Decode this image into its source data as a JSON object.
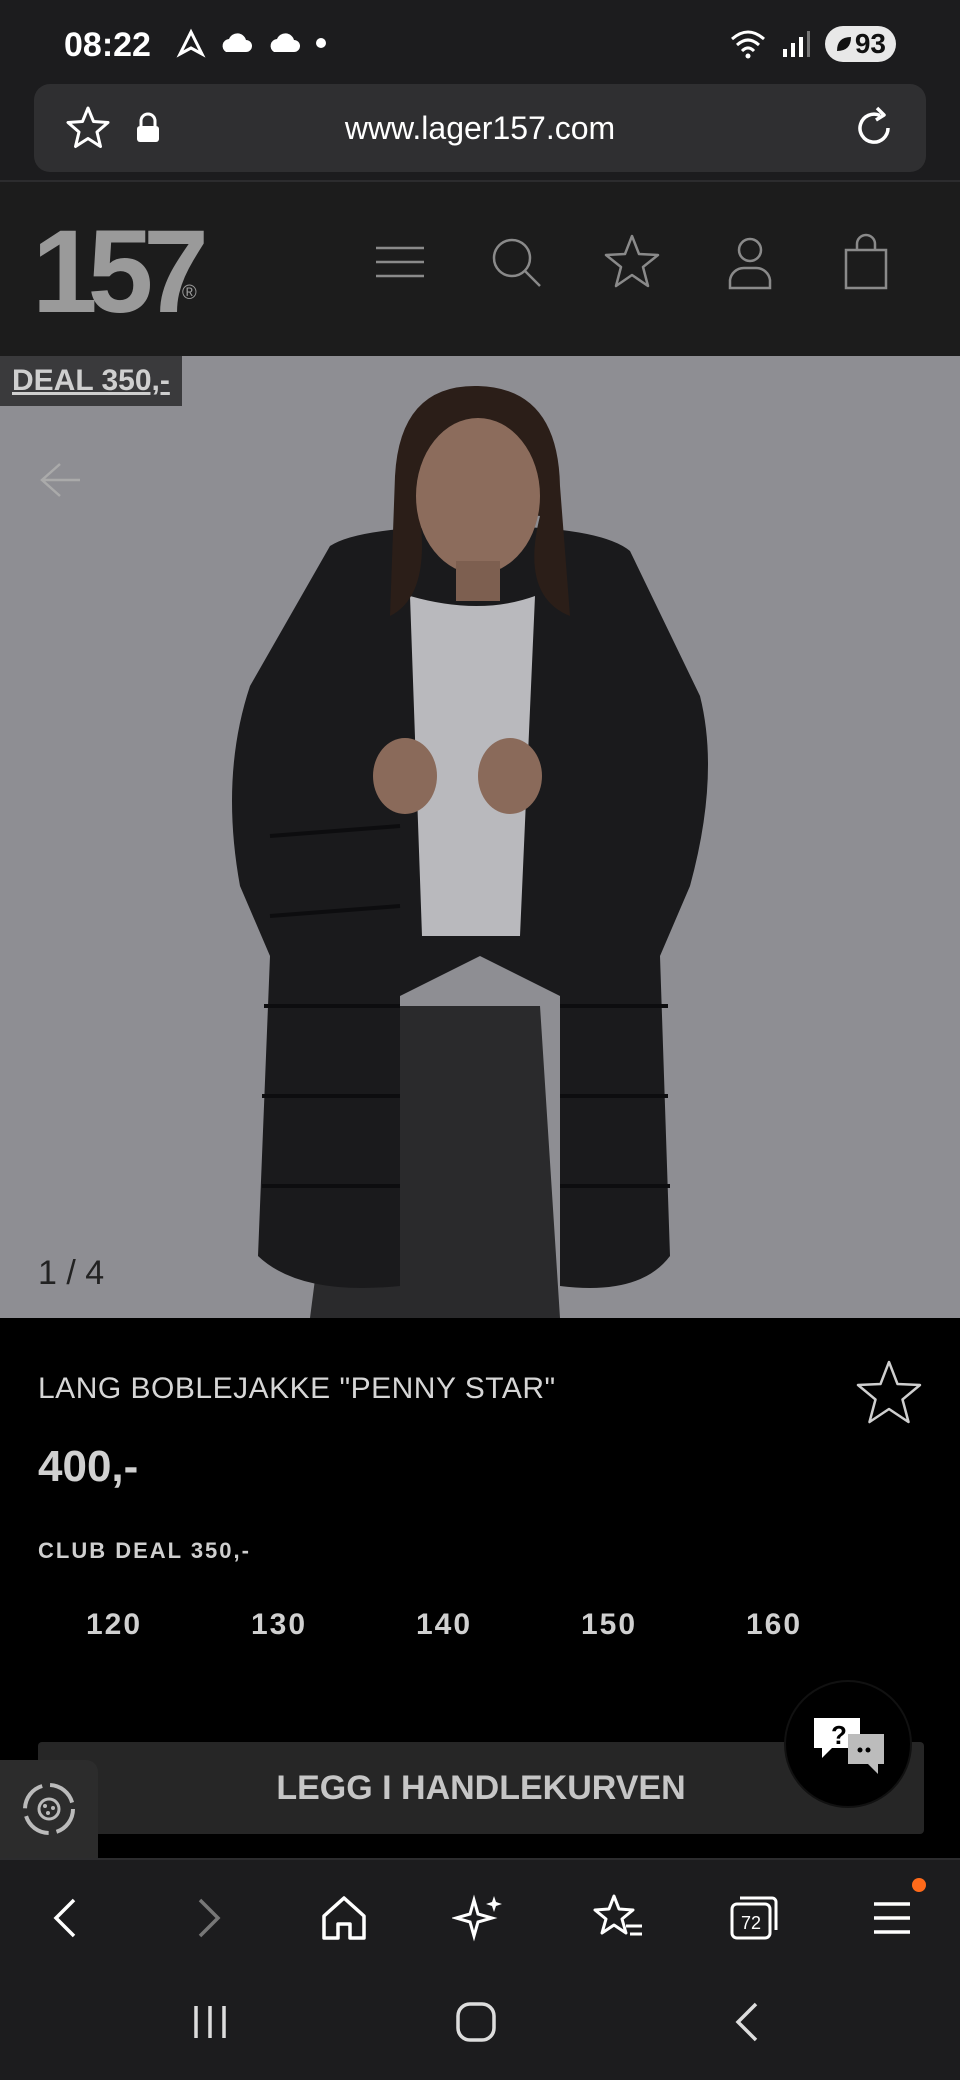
{
  "status_bar": {
    "time": "08:22",
    "battery": "93"
  },
  "browser": {
    "url": "www.lager157.com",
    "tab_count": "72"
  },
  "site": {
    "logo_text": "157",
    "logo_registered": "®"
  },
  "product": {
    "deal_badge": "DEAL 350,-",
    "image_counter": "1 / 4",
    "title": "LANG BOBLEJAKKE \"PENNY STAR\"",
    "price": "400,-",
    "club_deal": "CLUB DEAL 350,-",
    "sizes": [
      "120",
      "130",
      "140",
      "150",
      "160"
    ],
    "add_to_cart_label": "LEGG I HANDLEKURVEN"
  },
  "colors": {
    "accent_notification": "#ff6a1a",
    "page_background": "#000000",
    "header_background": "#1c1c1c"
  }
}
